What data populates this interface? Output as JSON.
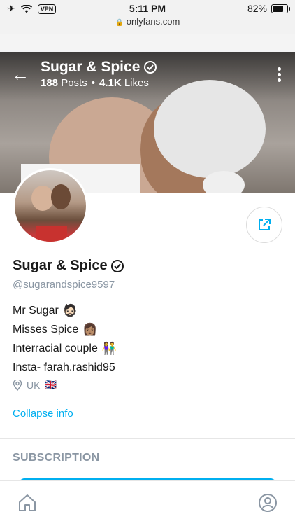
{
  "status_bar": {
    "vpn": "VPN",
    "time": "5:11 PM",
    "url": "onlyfans.com",
    "battery": "82%",
    "battery_level": 0.82
  },
  "header": {
    "name": "Sugar & Spice",
    "posts_count": "188",
    "posts_label": "Posts",
    "separator": "•",
    "likes_count": "4.1K",
    "likes_label": "Likes"
  },
  "profile": {
    "display_name": "Sugar & Spice",
    "handle": "@sugarandspice9597",
    "bio": [
      {
        "text": "Mr Sugar",
        "emoji": "🧔🏻"
      },
      {
        "text": "Misses Spice",
        "emoji": "👩🏽"
      },
      {
        "text": "Interracial couple",
        "emoji": "👫"
      },
      {
        "text": "Insta- farah.rashid95",
        "emoji": ""
      }
    ],
    "location": "UK",
    "location_flag": "🇬🇧",
    "collapse_label": "Collapse info"
  },
  "subscription": {
    "heading": "SUBSCRIPTION"
  },
  "colors": {
    "accent": "#00aff0",
    "muted": "#8a96a3"
  },
  "icons": [
    "airplane-icon",
    "wifi-icon",
    "lock-icon",
    "back-arrow-icon",
    "verified-icon",
    "more-vertical-icon",
    "share-icon",
    "location-pin-icon",
    "home-icon",
    "profile-icon"
  ]
}
